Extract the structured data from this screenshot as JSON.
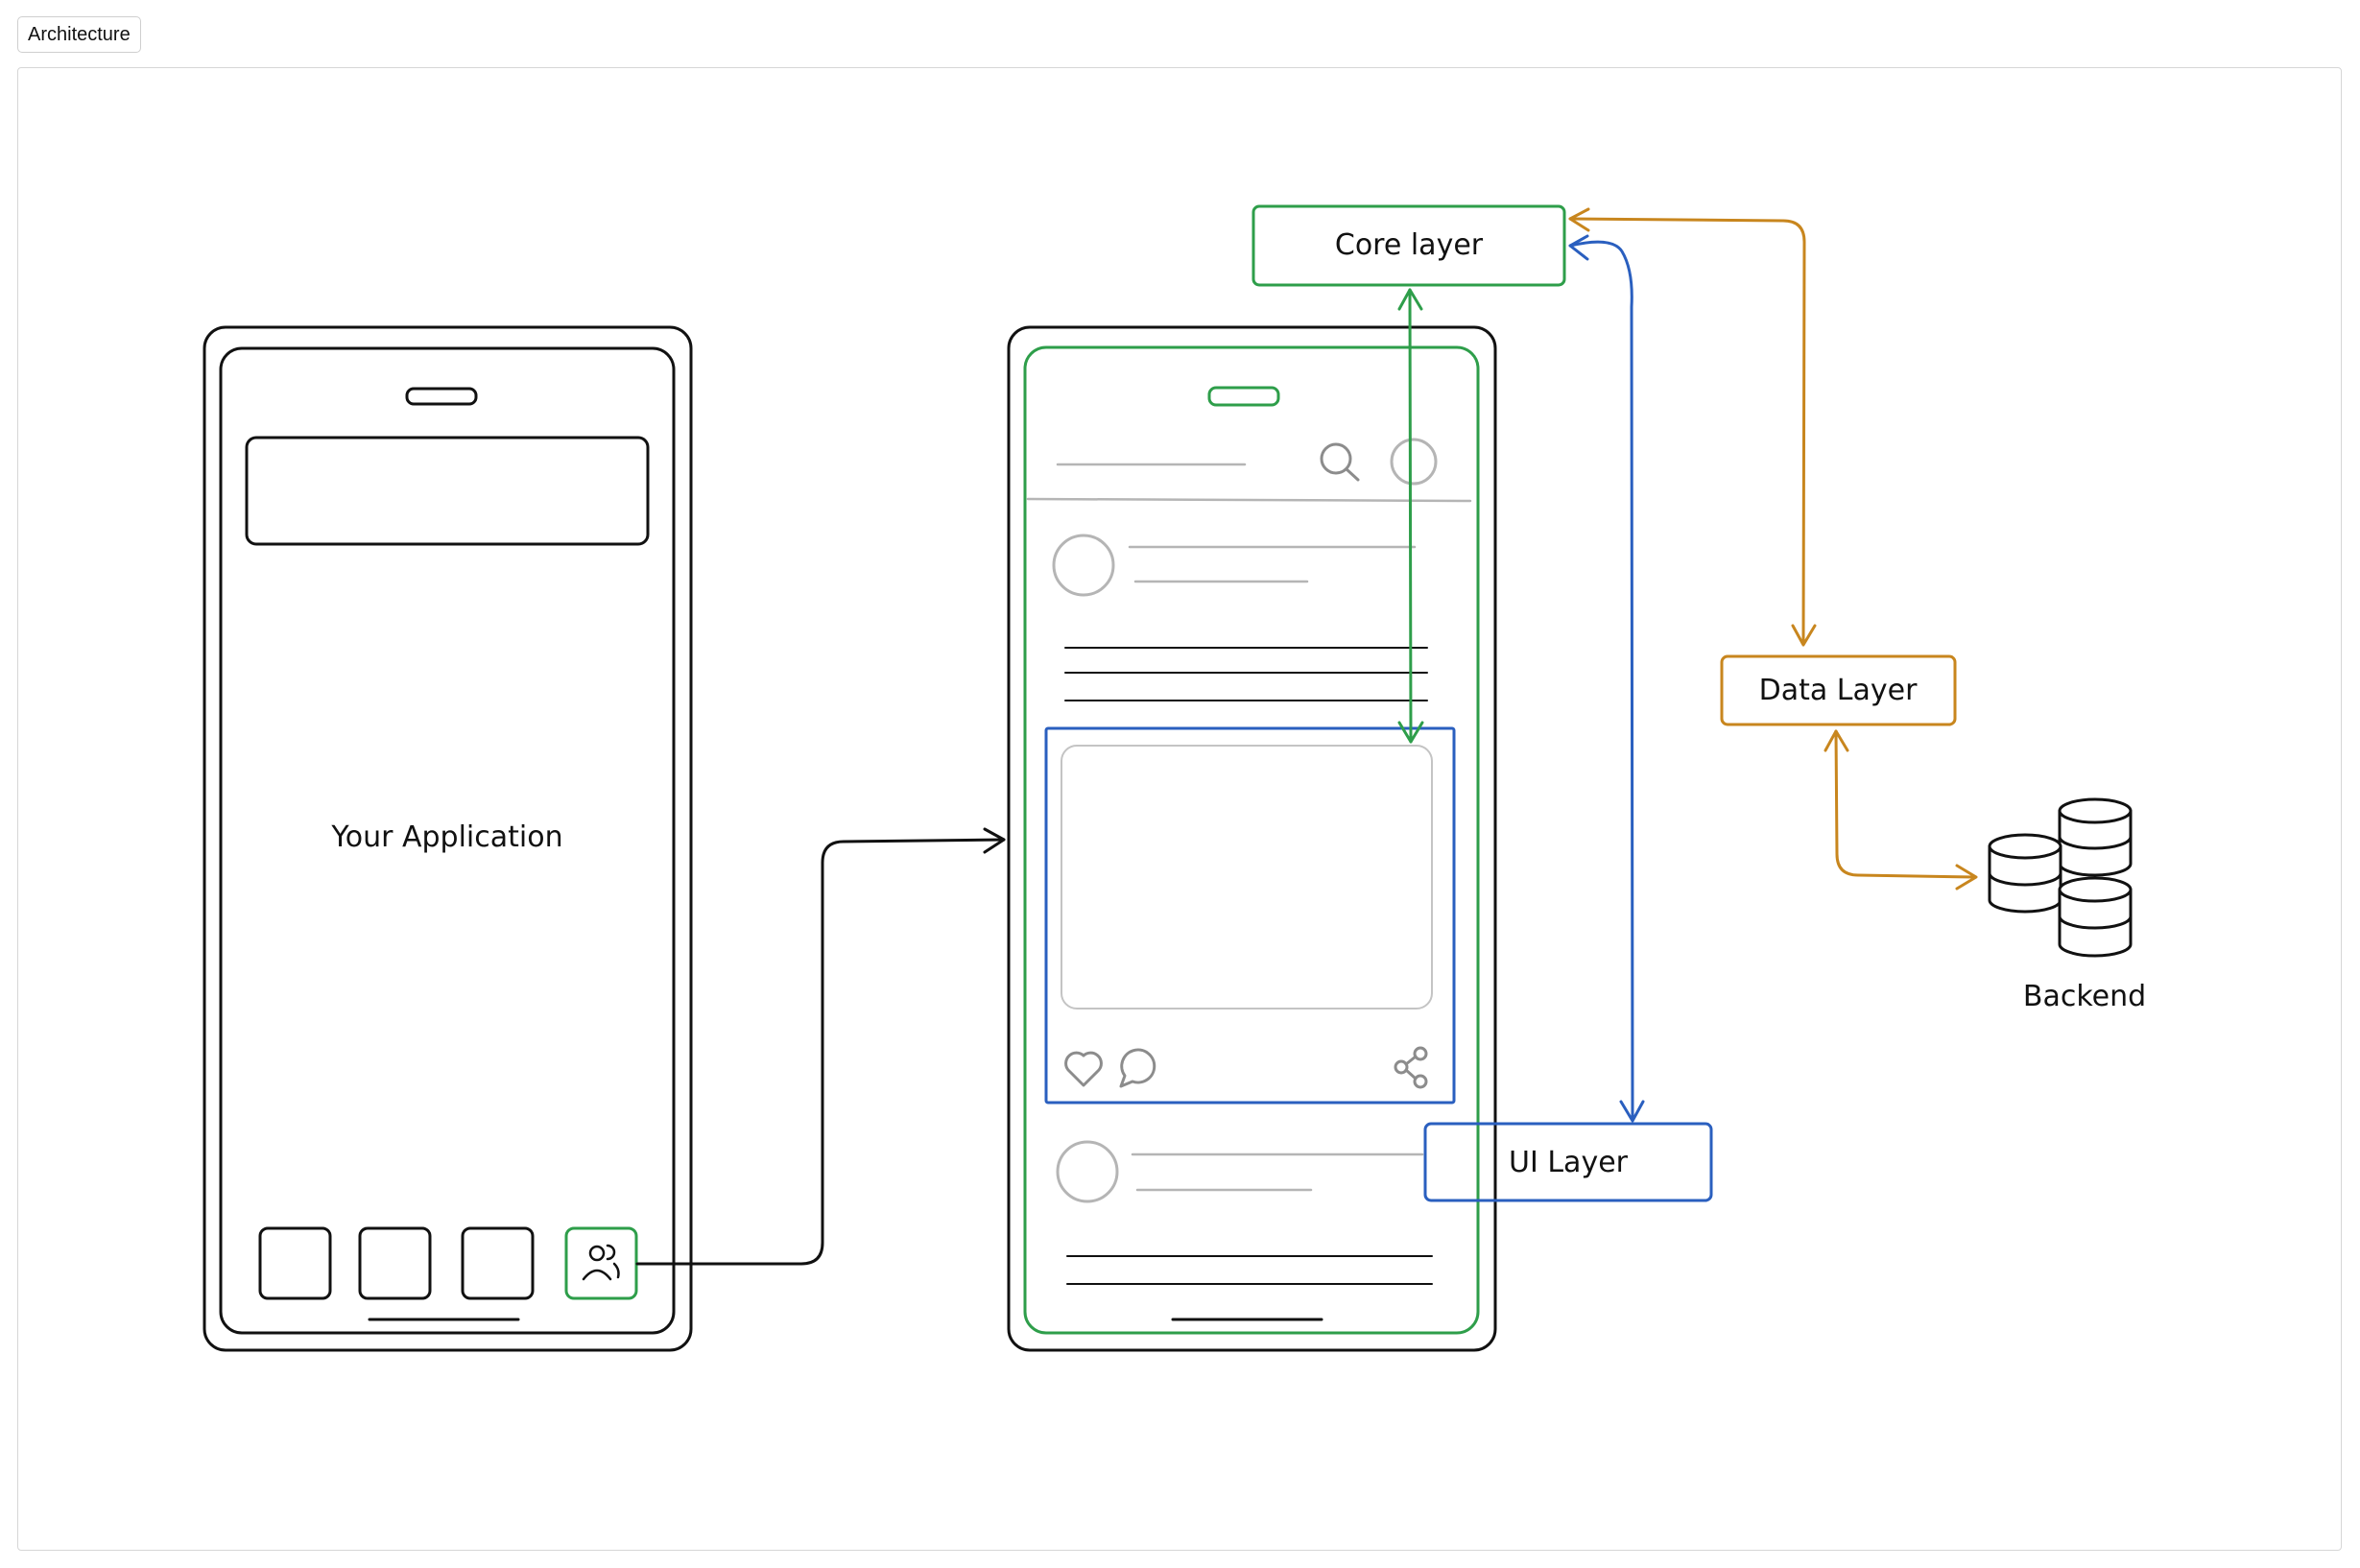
{
  "tab": {
    "label": "Architecture"
  },
  "diagram": {
    "app_label": "Your Application",
    "core_layer": "Core layer",
    "data_layer": "Data Layer",
    "ui_layer": "UI Layer",
    "backend": "Backend"
  },
  "colors": {
    "stroke": "#111111",
    "green": "#2e9e4a",
    "blue": "#2a5fbf",
    "orange": "#c8861e",
    "gray": "#b5b5b5"
  },
  "icons": [
    "users-icon",
    "search-icon",
    "heart-icon",
    "comment-icon",
    "share-icon",
    "database-icon"
  ]
}
